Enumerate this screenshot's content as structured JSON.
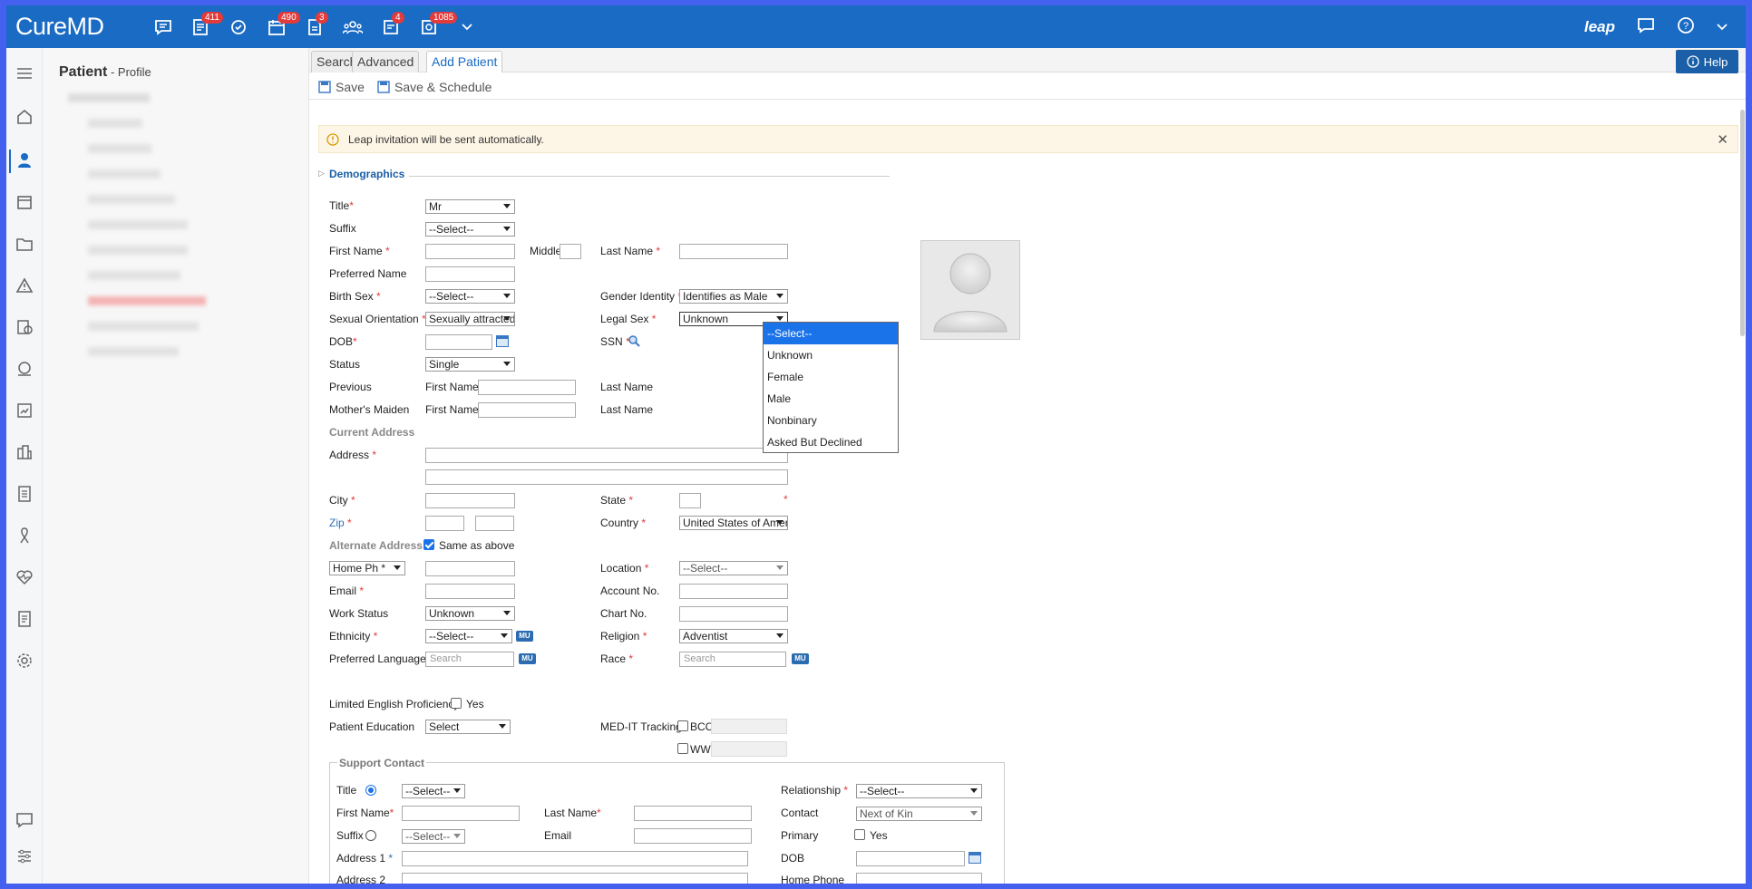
{
  "app": {
    "logo": "CureMD"
  },
  "topbar": {
    "badges": [
      "411",
      "490",
      "3",
      "4",
      "1085"
    ],
    "leap": "leap"
  },
  "patient": {
    "title": "Patient",
    "subtitle": " - Profile"
  },
  "tabs": [
    "Search",
    "Advanced",
    "Add Patient"
  ],
  "help": "Help",
  "toolbar": {
    "save": "Save",
    "save_schedule": "Save & Schedule"
  },
  "alert": "Leap invitation will be sent automatically.",
  "section": "Demographics",
  "labels": {
    "title": "Title",
    "suffix": "Suffix",
    "first_name": "First Name",
    "middle": "Middle",
    "last_name": "Last Name",
    "preferred_name": "Preferred Name",
    "birth_sex": "Birth Sex",
    "gender_identity": "Gender Identity",
    "sexual_orientation": "Sexual Orientation",
    "legal_sex": "Legal Sex",
    "dob": "DOB",
    "ssn": "SSN",
    "status": "Status",
    "previous": "Previous",
    "mothers_maiden": "Mother's Maiden",
    "current_address": "Current Address",
    "address": "Address",
    "city": "City",
    "state": "State",
    "zip": "Zip",
    "country": "Country",
    "alternate_address": "Alternate Address",
    "same_as_above": "Same as above",
    "location": "Location",
    "email": "Email",
    "account_no": "Account No.",
    "work_status": "Work Status",
    "chart_no": "Chart No.",
    "ethnicity": "Ethnicity",
    "religion": "Religion",
    "preferred_language": "Preferred Language",
    "race": "Race",
    "lep": "Limited English Proficiency",
    "yes": "Yes",
    "patient_education": "Patient Education",
    "med_it": "MED-IT Tracking",
    "bcc": "BCC",
    "ww": "WW"
  },
  "values": {
    "title": "Mr",
    "suffix": "--Select--",
    "birth_sex": "--Select--",
    "gender_identity": "Identifies as Male",
    "sexual_orientation": "Sexually attracted to",
    "legal_sex": "Unknown",
    "status": "Single",
    "country": "United States of America",
    "home_ph": "Home Ph *",
    "location": "--Select--",
    "work_status": "Unknown",
    "ethnicity": "--Select--",
    "religion": "Adventist",
    "search": "Search",
    "patient_education": "Select",
    "mu": "MU"
  },
  "legal_sex_options": [
    "--Select--",
    "Unknown",
    "Female",
    "Male",
    "Nonbinary",
    "Asked But Declined"
  ],
  "support": {
    "legend": "Support Contact",
    "title": "Title",
    "first_name": "First Name",
    "last_name": "Last Name",
    "suffix": "Suffix",
    "email": "Email",
    "address1": "Address 1",
    "address2": "Address 2",
    "relationship": "Relationship",
    "contact": "Contact",
    "primary": "Primary",
    "dob": "DOB",
    "home_phone": "Home Phone",
    "yes": "Yes",
    "select": "--Select--",
    "contact_value": "Next of Kin"
  }
}
